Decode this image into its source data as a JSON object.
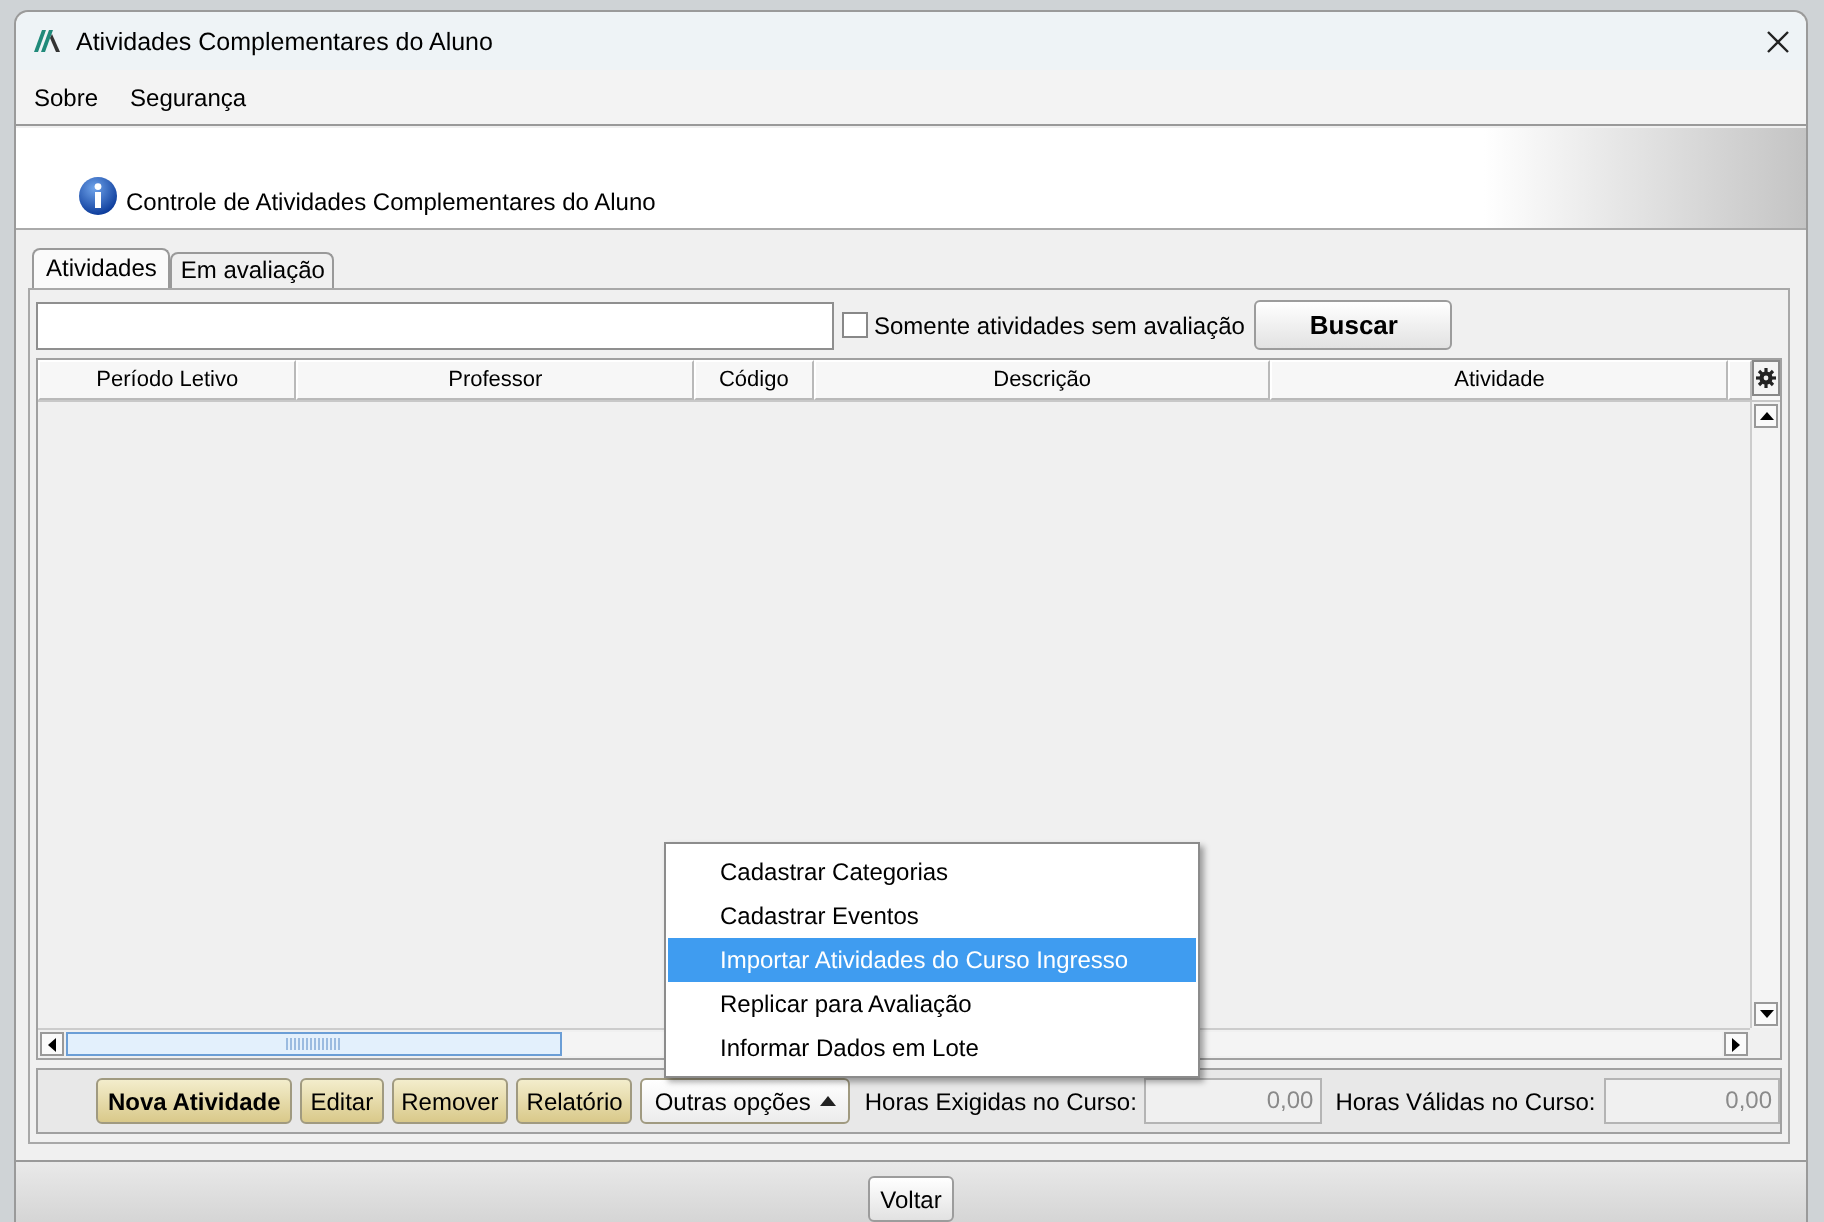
{
  "window": {
    "title": "Atividades Complementares do Aluno"
  },
  "menu": [
    {
      "label": "Sobre"
    },
    {
      "label": "Segurança"
    }
  ],
  "header": {
    "title": "Controle de Atividades Complementares do Aluno"
  },
  "tabs": [
    {
      "label": "Atividades",
      "selected": true
    },
    {
      "label": "Em avaliação",
      "selected": false
    }
  ],
  "filter": {
    "checkbox": {
      "label": "Somente atividades sem avaliação",
      "checked": false
    },
    "button": "Buscar"
  },
  "table": {
    "columns": [
      "Período Letivo",
      "Professor",
      "Código",
      "Descrição",
      "Atividade"
    ]
  },
  "toolbar": {
    "buttons": [
      {
        "label": "Nova Atividade",
        "kind": "primary"
      },
      {
        "label": "Editar",
        "kind": "action"
      },
      {
        "label": "Remover",
        "kind": "action"
      },
      {
        "label": "Relatório",
        "kind": "action"
      },
      {
        "label": "Outras opções",
        "kind": "dropdown"
      }
    ],
    "fields": [
      {
        "label": "Horas Exigidas no Curso:",
        "value": "0,00"
      },
      {
        "label": "Horas Válidas no Curso:",
        "value": "0,00"
      }
    ]
  },
  "popup_menu": [
    {
      "label": "Cadastrar Categorias",
      "selected": false
    },
    {
      "label": "Cadastrar Eventos",
      "selected": false
    },
    {
      "label": "Importar Atividades do Curso Ingresso",
      "selected": true
    },
    {
      "label": "Replicar para Avaliação",
      "selected": false
    },
    {
      "label": "Informar Dados em Lote",
      "selected": false
    }
  ],
  "footer": {
    "button": "Voltar"
  }
}
